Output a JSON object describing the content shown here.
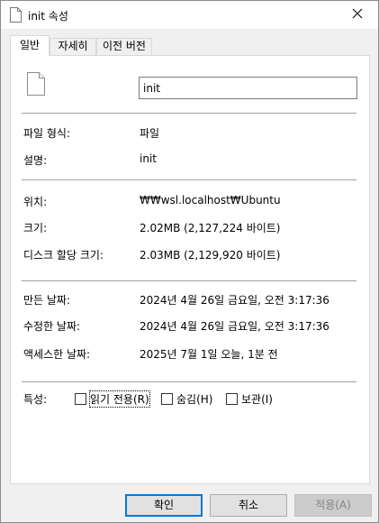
{
  "window": {
    "title": "init 속성",
    "icon": "file-icon",
    "close_icon": "close-icon"
  },
  "tabs": [
    {
      "label": "일반",
      "active": true
    },
    {
      "label": "자세히",
      "active": false
    },
    {
      "label": "이전 버전",
      "active": false
    }
  ],
  "general": {
    "file_name": "init",
    "rows": {
      "file_type": {
        "label": "파일 형식:",
        "value": "파일"
      },
      "description": {
        "label": "설명:",
        "value": "init"
      },
      "location": {
        "label": "위치:",
        "value": "₩₩wsl.localhost₩Ubuntu"
      },
      "size": {
        "label": "크기:",
        "value": "2.02MB (2,127,224 바이트)"
      },
      "size_on_disk": {
        "label": "디스크 할당 크기:",
        "value": "2.03MB (2,129,920 바이트)"
      },
      "created": {
        "label": "만든 날짜:",
        "value": "2024년 4월 26일 금요일, 오전 3:17:36"
      },
      "modified": {
        "label": "수정한 날짜:",
        "value": "2024년 4월 26일 금요일, 오전 3:17:36"
      },
      "accessed": {
        "label": "액세스한 날짜:",
        "value": "2025년 7월 1일 오늘, 1분 전"
      }
    },
    "attributes": {
      "label": "특성:",
      "readonly": "읽기 전용(R)",
      "hidden": "숨김(H)",
      "archive": "보관(I)"
    }
  },
  "buttons": {
    "ok": "확인",
    "cancel": "취소",
    "apply": "적용(A)"
  },
  "colors": {
    "accent": "#0078d7"
  }
}
